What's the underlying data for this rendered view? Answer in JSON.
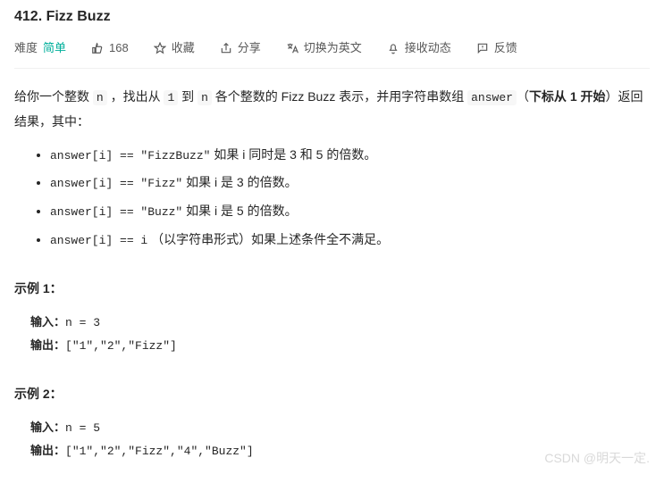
{
  "title": "412. Fizz Buzz",
  "meta": {
    "difficulty_label": "难度",
    "difficulty_value": "简单",
    "likes": "168",
    "favorite": "收藏",
    "share": "分享",
    "switch_lang": "切换为英文",
    "subscribe": "接收动态",
    "feedback": "反馈"
  },
  "desc": {
    "p1_a": "给你一个整数 ",
    "p1_n": "n",
    "p1_b": " ，找出从 ",
    "p1_one": "1",
    "p1_c": " 到 ",
    "p1_n2": "n",
    "p1_d": " 各个整数的 Fizz Buzz 表示，并用字符串数组 ",
    "p1_ans": "answer",
    "p1_e": "（",
    "p1_bold": "下标从 1 开始",
    "p1_f": "）返回结果，其中："
  },
  "rules": [
    {
      "code": "answer[i] == \"FizzBuzz\"",
      "text": " 如果 i 同时是 3 和 5 的倍数。"
    },
    {
      "code": "answer[i] == \"Fizz\"",
      "text": " 如果 i 是 3 的倍数。"
    },
    {
      "code": "answer[i] == \"Buzz\"",
      "text": " 如果 i 是 5 的倍数。"
    },
    {
      "code": "answer[i] == i",
      "text": " （以字符串形式）如果上述条件全不满足。"
    }
  ],
  "examples": [
    {
      "label": "示例 1：",
      "input_label": "输入：",
      "input_value": "n = 3",
      "output_label": "输出：",
      "output_value": "[\"1\",\"2\",\"Fizz\"]"
    },
    {
      "label": "示例 2：",
      "input_label": "输入：",
      "input_value": "n = 5",
      "output_label": "输出：",
      "output_value": "[\"1\",\"2\",\"Fizz\",\"4\",\"Buzz\"]"
    }
  ],
  "watermark": "CSDN @明天一定."
}
